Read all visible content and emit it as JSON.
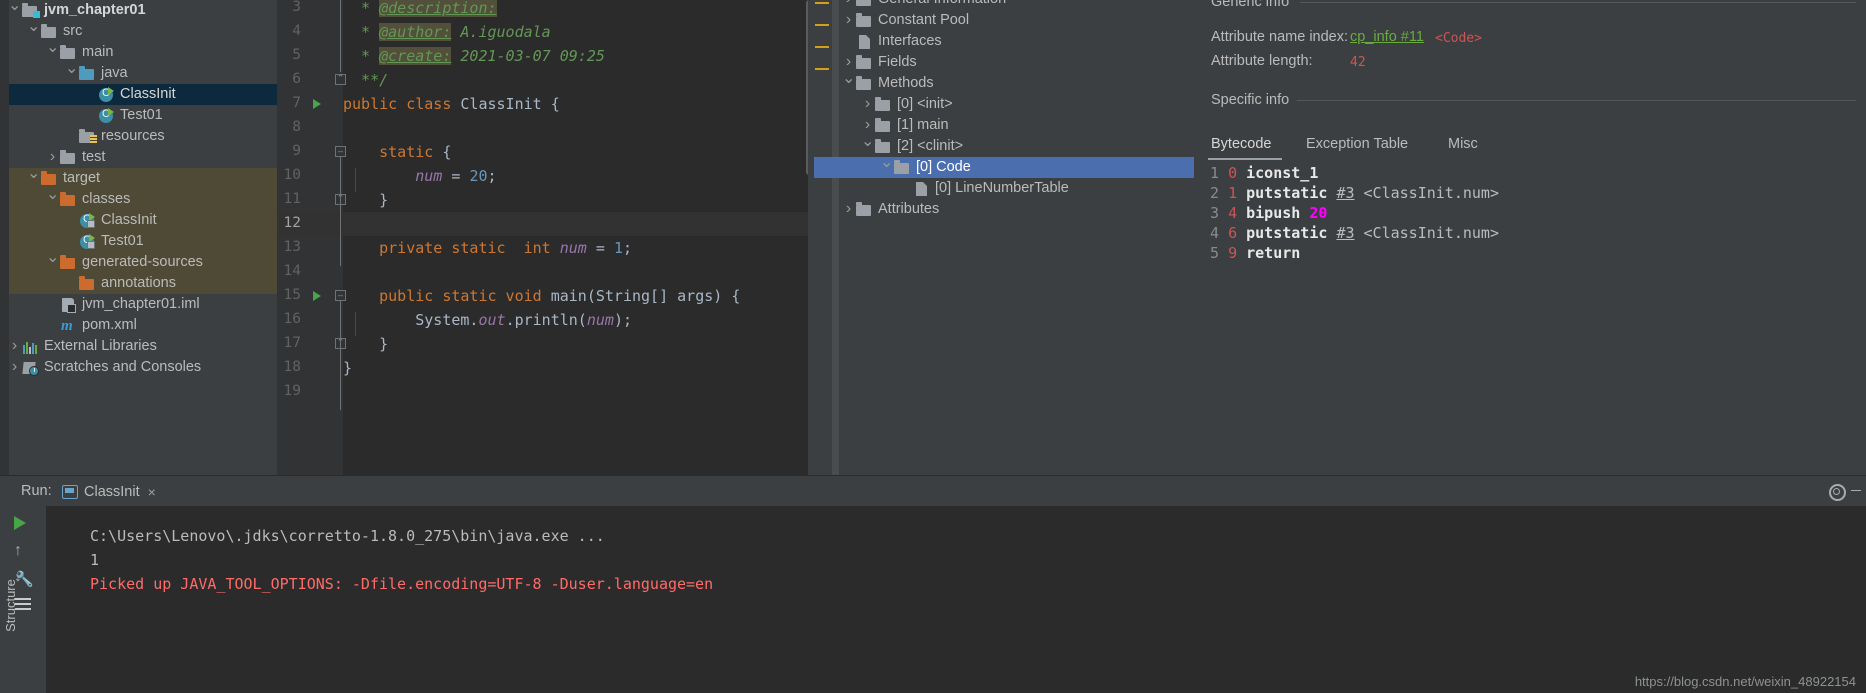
{
  "project_tree": {
    "items": [
      {
        "label": "jvm_chapter01",
        "indent": 1,
        "chev": "down",
        "icon": "module-folder-icon",
        "bold": true,
        "bg": "none"
      },
      {
        "label": "src",
        "indent": 2,
        "chev": "down",
        "icon": "folder-grey-icon",
        "bold": false,
        "bg": "none"
      },
      {
        "label": "main",
        "indent": 3,
        "chev": "down",
        "icon": "folder-grey-icon",
        "bold": false,
        "bg": "none"
      },
      {
        "label": "java",
        "indent": 4,
        "chev": "down",
        "icon": "folder-blue-icon",
        "bold": false,
        "bg": "none"
      },
      {
        "label": "ClassInit",
        "indent": 5,
        "chev": "blank",
        "icon": "java-class-icon",
        "bold": false,
        "bg": "selected"
      },
      {
        "label": "Test01",
        "indent": 5,
        "chev": "blank",
        "icon": "java-class-icon",
        "bold": false,
        "bg": "none"
      },
      {
        "label": "resources",
        "indent": 4,
        "chev": "blank",
        "icon": "folder-resources-icon",
        "bold": false,
        "bg": "none"
      },
      {
        "label": "test",
        "indent": 3,
        "chev": "right",
        "icon": "folder-grey-icon",
        "bold": false,
        "bg": "none"
      },
      {
        "label": "target",
        "indent": 2,
        "chev": "down",
        "icon": "folder-orange-icon",
        "bold": false,
        "bg": "target"
      },
      {
        "label": "classes",
        "indent": 3,
        "chev": "down",
        "icon": "folder-orange-icon",
        "bold": false,
        "bg": "target"
      },
      {
        "label": "ClassInit",
        "indent": 4,
        "chev": "blank",
        "icon": "java-class-compiled-icon",
        "bold": false,
        "bg": "target"
      },
      {
        "label": "Test01",
        "indent": 4,
        "chev": "blank",
        "icon": "java-class-compiled-icon",
        "bold": false,
        "bg": "target"
      },
      {
        "label": "generated-sources",
        "indent": 3,
        "chev": "down",
        "icon": "folder-orange-icon",
        "bold": false,
        "bg": "target"
      },
      {
        "label": "annotations",
        "indent": 4,
        "chev": "blank",
        "icon": "folder-orange-icon",
        "bold": false,
        "bg": "target"
      },
      {
        "label": "jvm_chapter01.iml",
        "indent": 3,
        "chev": "blank",
        "icon": "module-file-icon",
        "bold": false,
        "bg": "none"
      },
      {
        "label": "pom.xml",
        "indent": 3,
        "chev": "blank",
        "icon": "maven-icon",
        "bold": false,
        "bg": "none"
      },
      {
        "label": "External Libraries",
        "indent": 1,
        "chev": "right",
        "icon": "external-libraries-icon",
        "bold": false,
        "bg": "none"
      },
      {
        "label": "Scratches and Consoles",
        "indent": 1,
        "chev": "right",
        "icon": "scratches-icon",
        "bold": false,
        "bg": "none"
      }
    ]
  },
  "editor": {
    "first_line": 3,
    "last_line": 19,
    "current_line": 12,
    "lines": [
      {
        "n": 3,
        "runmark": false,
        "fold": "",
        "tokens": [
          {
            "t": "  * ",
            "c": "jd"
          },
          {
            "t": "@description:",
            "c": "jdt"
          }
        ]
      },
      {
        "n": 4,
        "runmark": false,
        "fold": "",
        "tokens": [
          {
            "t": "  * ",
            "c": "jd"
          },
          {
            "t": "@author:",
            "c": "jdt"
          },
          {
            "t": " A.iguodala",
            "c": "jdv"
          }
        ]
      },
      {
        "n": 5,
        "runmark": false,
        "fold": "",
        "tokens": [
          {
            "t": "  * ",
            "c": "jd"
          },
          {
            "t": "@create:",
            "c": "jdt"
          },
          {
            "t": " 2021-03-07 09:25",
            "c": "jdv"
          }
        ]
      },
      {
        "n": 6,
        "runmark": false,
        "fold": "end",
        "tokens": [
          {
            "t": "  **/",
            "c": "jd"
          }
        ]
      },
      {
        "n": 7,
        "runmark": true,
        "fold": "",
        "tokens": [
          {
            "t": "public class ",
            "c": "k"
          },
          {
            "t": "ClassInit",
            "c": "t"
          },
          {
            "t": " {",
            "c": "w"
          }
        ]
      },
      {
        "n": 8,
        "runmark": false,
        "fold": "",
        "tokens": []
      },
      {
        "n": 9,
        "runmark": false,
        "fold": "start",
        "tokens": [
          {
            "t": "    ",
            "c": "w"
          },
          {
            "t": "static",
            "c": "k"
          },
          {
            "t": " {",
            "c": "w"
          }
        ]
      },
      {
        "n": 10,
        "runmark": false,
        "fold": "",
        "tokens": [
          {
            "t": "        ",
            "c": "w"
          },
          {
            "t": "num",
            "c": "f"
          },
          {
            "t": " = ",
            "c": "w"
          },
          {
            "t": "20",
            "c": "n"
          },
          {
            "t": ";",
            "c": "w"
          }
        ]
      },
      {
        "n": 11,
        "runmark": false,
        "fold": "end",
        "tokens": [
          {
            "t": "    }",
            "c": "w"
          }
        ]
      },
      {
        "n": 12,
        "runmark": false,
        "fold": "",
        "tokens": []
      },
      {
        "n": 13,
        "runmark": false,
        "fold": "",
        "tokens": [
          {
            "t": "    ",
            "c": "w"
          },
          {
            "t": "private static ",
            "c": "k"
          },
          {
            "t": " ",
            "c": "w"
          },
          {
            "t": "int ",
            "c": "k"
          },
          {
            "t": "num",
            "c": "f"
          },
          {
            "t": " = ",
            "c": "w"
          },
          {
            "t": "1",
            "c": "n"
          },
          {
            "t": ";",
            "c": "w"
          }
        ]
      },
      {
        "n": 14,
        "runmark": false,
        "fold": "",
        "tokens": []
      },
      {
        "n": 15,
        "runmark": true,
        "fold": "start",
        "tokens": [
          {
            "t": "    ",
            "c": "w"
          },
          {
            "t": "public static void ",
            "c": "k"
          },
          {
            "t": "main",
            "c": "w"
          },
          {
            "t": "(String[] args) {",
            "c": "w"
          }
        ]
      },
      {
        "n": 16,
        "runmark": false,
        "fold": "",
        "tokens": [
          {
            "t": "        System.",
            "c": "w"
          },
          {
            "t": "out",
            "c": "f"
          },
          {
            "t": ".println(",
            "c": "w"
          },
          {
            "t": "num",
            "c": "f"
          },
          {
            "t": ");",
            "c": "w"
          }
        ]
      },
      {
        "n": 17,
        "runmark": false,
        "fold": "end",
        "tokens": [
          {
            "t": "    }",
            "c": "w"
          }
        ]
      },
      {
        "n": 18,
        "runmark": false,
        "fold": "",
        "tokens": [
          {
            "t": "}",
            "c": "w"
          }
        ]
      },
      {
        "n": 19,
        "runmark": false,
        "fold": "",
        "tokens": []
      }
    ]
  },
  "structure_tree": {
    "items": [
      {
        "label": "General Information",
        "indent": 1,
        "chev": "right",
        "icon": "folder-grey-icon",
        "selected": false
      },
      {
        "label": "Constant Pool",
        "indent": 1,
        "chev": "right",
        "icon": "folder-grey-icon",
        "selected": false
      },
      {
        "label": "Interfaces",
        "indent": 1,
        "chev": "blank",
        "icon": "file-doc-icon",
        "selected": false
      },
      {
        "label": "Fields",
        "indent": 1,
        "chev": "right",
        "icon": "folder-grey-icon",
        "selected": false
      },
      {
        "label": "Methods",
        "indent": 1,
        "chev": "down",
        "icon": "folder-grey-icon",
        "selected": false
      },
      {
        "label": "[0] <init>",
        "indent": 2,
        "chev": "right",
        "icon": "folder-grey-icon",
        "selected": false
      },
      {
        "label": "[1] main",
        "indent": 2,
        "chev": "right",
        "icon": "folder-grey-icon",
        "selected": false
      },
      {
        "label": "[2] <clinit>",
        "indent": 2,
        "chev": "down",
        "icon": "folder-grey-icon",
        "selected": false
      },
      {
        "label": "[0] Code",
        "indent": 3,
        "chev": "down",
        "icon": "folder-grey-icon",
        "selected": true
      },
      {
        "label": "[0] LineNumberTable",
        "indent": 4,
        "chev": "blank",
        "icon": "file-doc-icon",
        "selected": false
      },
      {
        "label": "Attributes",
        "indent": 1,
        "chev": "right",
        "icon": "folder-grey-icon",
        "selected": false
      }
    ]
  },
  "info_panel": {
    "generic_info_title": "Generic info",
    "specific_info_title": "Specific info",
    "rows": [
      {
        "label": "Attribute name index:",
        "link": "cp_info #11",
        "extra": "<Code>"
      },
      {
        "label": "Attribute length:",
        "link": "",
        "extra": "42"
      }
    ],
    "tabs": [
      {
        "label": "Bytecode",
        "active": true
      },
      {
        "label": "Exception Table",
        "active": false
      },
      {
        "label": "Misc",
        "active": false
      }
    ],
    "bytecode": [
      {
        "line": "1",
        "offset": "0",
        "op": "iconst_1",
        "ref": "",
        "num": "",
        "comment": ""
      },
      {
        "line": "2",
        "offset": "1",
        "op": "putstatic",
        "ref": "#3",
        "num": "",
        "comment": "<ClassInit.num>"
      },
      {
        "line": "3",
        "offset": "4",
        "op": "bipush",
        "ref": "",
        "num": "20",
        "comment": ""
      },
      {
        "line": "4",
        "offset": "6",
        "op": "putstatic",
        "ref": "#3",
        "num": "",
        "comment": "<ClassInit.num>"
      },
      {
        "line": "5",
        "offset": "9",
        "op": "return",
        "ref": "",
        "num": "",
        "comment": ""
      }
    ]
  },
  "run_panel": {
    "run_label": "Run:",
    "tab_name": "ClassInit",
    "tab_close": "×",
    "console_lines": [
      {
        "text": "C:\\Users\\Lenovo\\.jdks\\corretto-1.8.0_275\\bin\\java.exe ...",
        "color": "white"
      },
      {
        "text": "1",
        "color": "white"
      },
      {
        "text": "Picked up JAVA_TOOL_OPTIONS: -Dfile.encoding=UTF-8 -Duser.language=en",
        "color": "red"
      }
    ],
    "side_buttons": [
      {
        "name": "rerun-button",
        "icon": "play-icon"
      },
      {
        "name": "up-stack-button",
        "icon": "arrow-up-icon"
      },
      {
        "name": "down-stack-button",
        "icon": "arrow-down-icon"
      },
      {
        "name": "settings-wrench-button",
        "icon": "wrench-icon"
      },
      {
        "name": "print-button",
        "icon": "stack-icon"
      }
    ],
    "structure_tool_label": "Structure",
    "settings_icon": "gear-icon"
  },
  "watermark": "https://blog.csdn.net/weixin_48922154",
  "colors": {
    "accent_selection": "#4b6eaf",
    "project_selection": "#0d293e",
    "target_bg": "#4e4a35",
    "editor_bg": "#2b2b2b",
    "panel_bg": "#3c3f41",
    "keyword": "#cc7832",
    "number": "#6897bb",
    "javadoc": "#629755",
    "error_red": "#ff6b68"
  }
}
